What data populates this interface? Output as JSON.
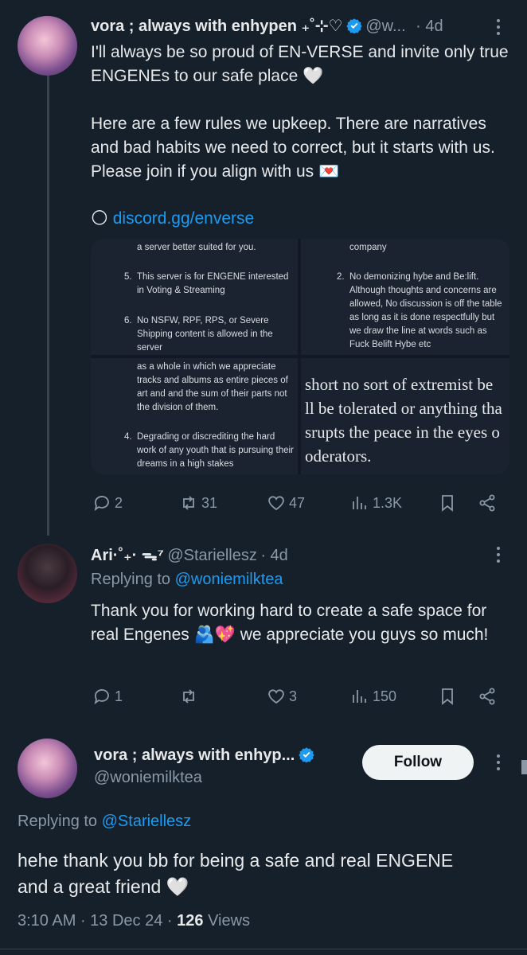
{
  "tweet1": {
    "display_name": "vora ; always with enhypen ₊˚⊹♡",
    "handle": "@w...",
    "time": "· 4d",
    "text_p1": "I'll always be so proud of EN-VERSE and invite only true ENGENEs to our safe place 🤍",
    "text_p2": "Here are a few rules we upkeep. There are narratives and bad habits we need to correct, but it starts with us. Please join if you align with us 💌",
    "link_emoji": "🌕",
    "link": "discord.gg/enverse",
    "media": {
      "tile1_top": "a server better suited for you.",
      "tile1_rule5_num": "5.",
      "tile1_rule5": "This server is for ENGENE interested in Voting & Streaming",
      "tile1_rule6_num": "6.",
      "tile1_rule6": "No NSFW, RPF, RPS, or Severe Shipping content is allowed in the server",
      "tile2_top": "company",
      "tile2_rule2_num": "2.",
      "tile2_rule2": "No demonizing hybe and Be:lift. Although thoughts and concerns are allowed, No discussion is off the table as long as it is done respectfully but we draw the line at words such as Fuck Belift Hybe etc",
      "tile3_top": "as a whole in which we appreciate tracks and albums as entire pieces of art and and the sum of their parts not the division of them.",
      "tile3_rule4_num": "4.",
      "tile3_rule4": "Degrading or discrediting the hard work of any youth that is pursuing their dreams in a high stakes",
      "tile4_line1": "short no sort of extremist be",
      "tile4_line2": "ll be tolerated or anything tha",
      "tile4_line3": "srupts the peace in the eyes o",
      "tile4_line4": "oderators."
    },
    "actions": {
      "replies": "2",
      "reposts": "31",
      "likes": "47",
      "views": "1.3K"
    }
  },
  "tweet2": {
    "display_name": "Ari·˚₊· ᯓ⁷",
    "handle": "@Stariellesz",
    "time": "· 4d",
    "replying_label": "Replying to",
    "replying_to": "@woniemilktea",
    "text": "Thank you for working hard to create a safe space for real Engenes 🫂💖 we appreciate you guys so much!",
    "actions": {
      "replies": "1",
      "reposts": "",
      "likes": "3",
      "views": "150"
    }
  },
  "main": {
    "display_name": "vora ; always with enhyp...",
    "handle": "@woniemilktea",
    "follow_label": "Follow",
    "replying_label": "Replying to",
    "replying_to": "@Stariellesz",
    "text": "hehe thank you bb for being a safe and real ENGENE and a great friend 🤍",
    "time": "3:10 AM",
    "date": "13 Dec 24",
    "views_count": "126",
    "views_label": "Views"
  },
  "colors": {
    "background": "#15202b",
    "accent": "#1d9bf0",
    "text": "#e7e9ea",
    "muted": "#8b98a5"
  },
  "icons": [
    "verified-icon",
    "more-icon",
    "reply-icon",
    "repost-icon",
    "like-icon",
    "views-icon",
    "bookmark-icon",
    "share-icon"
  ]
}
